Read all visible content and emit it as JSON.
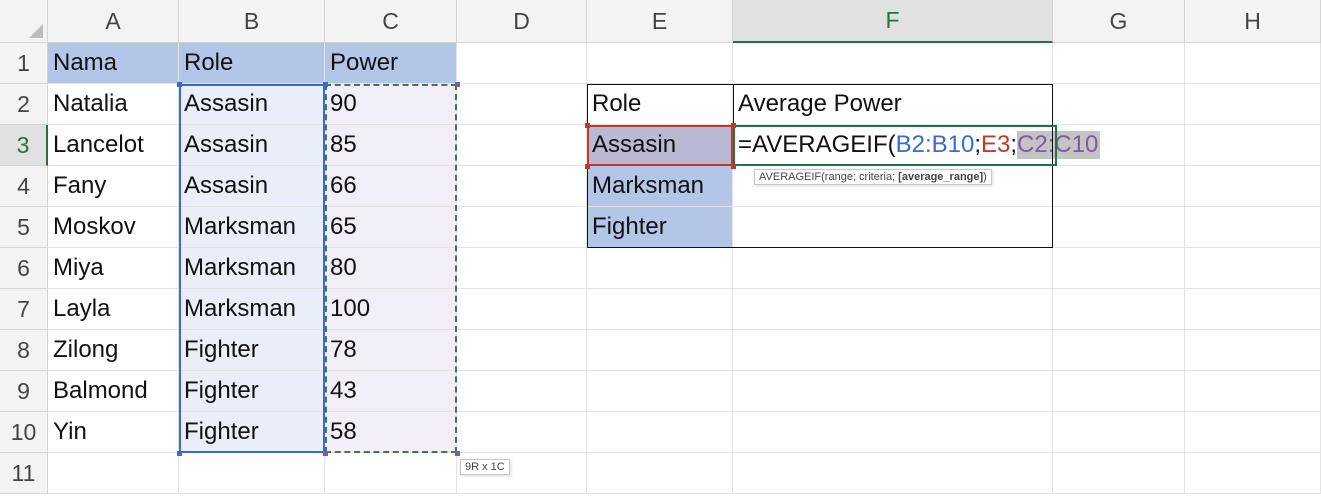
{
  "columns": [
    "A",
    "B",
    "C",
    "D",
    "E",
    "F",
    "G",
    "H"
  ],
  "rows": [
    "1",
    "2",
    "3",
    "4",
    "5",
    "6",
    "7",
    "8",
    "9",
    "10",
    "11"
  ],
  "cells": {
    "A1": "Nama",
    "B1": "Role",
    "C1": "Power",
    "A2": "Natalia",
    "B2": "Assasin",
    "C2": "90",
    "A3": "Lancelot",
    "B3": "Assasin",
    "C3": "85",
    "A4": "Fany",
    "B4": "Assasin",
    "C4": "66",
    "A5": "Moskov",
    "B5": "Marksman",
    "C5": "65",
    "A6": "Miya",
    "B6": "Marksman",
    "C6": "80",
    "A7": "Layla",
    "B7": "Marksman",
    "C7": "100",
    "A8": "Zilong",
    "B8": "Fighter",
    "C8": "78",
    "A9": "Balmond",
    "B9": "Fighter",
    "C9": "43",
    "A10": "Yin",
    "B10": "Fighter",
    "C10": "58",
    "E2": "Role",
    "F2": "Average Power",
    "E3": "Assasin",
    "E4": "Marksman",
    "E5": "Fighter"
  },
  "formula": {
    "prefix": "=AVERAGEIF(",
    "range1": "B2:B10",
    "sep1": ";",
    "criteria": "E3",
    "sep2": ";",
    "range2": "C2:C10"
  },
  "tooltip": {
    "before": "AVERAGEIF(range; criteria; ",
    "bold": "[average_range]",
    "after": ")"
  },
  "size_tip": "9R x 1C",
  "colors": {
    "header_fill": "#b4c6e7",
    "range_blue": "#3a6bc9",
    "criteria_red": "#c0392b",
    "range_purple": "#7f5aa6",
    "active_header": "#217346"
  }
}
